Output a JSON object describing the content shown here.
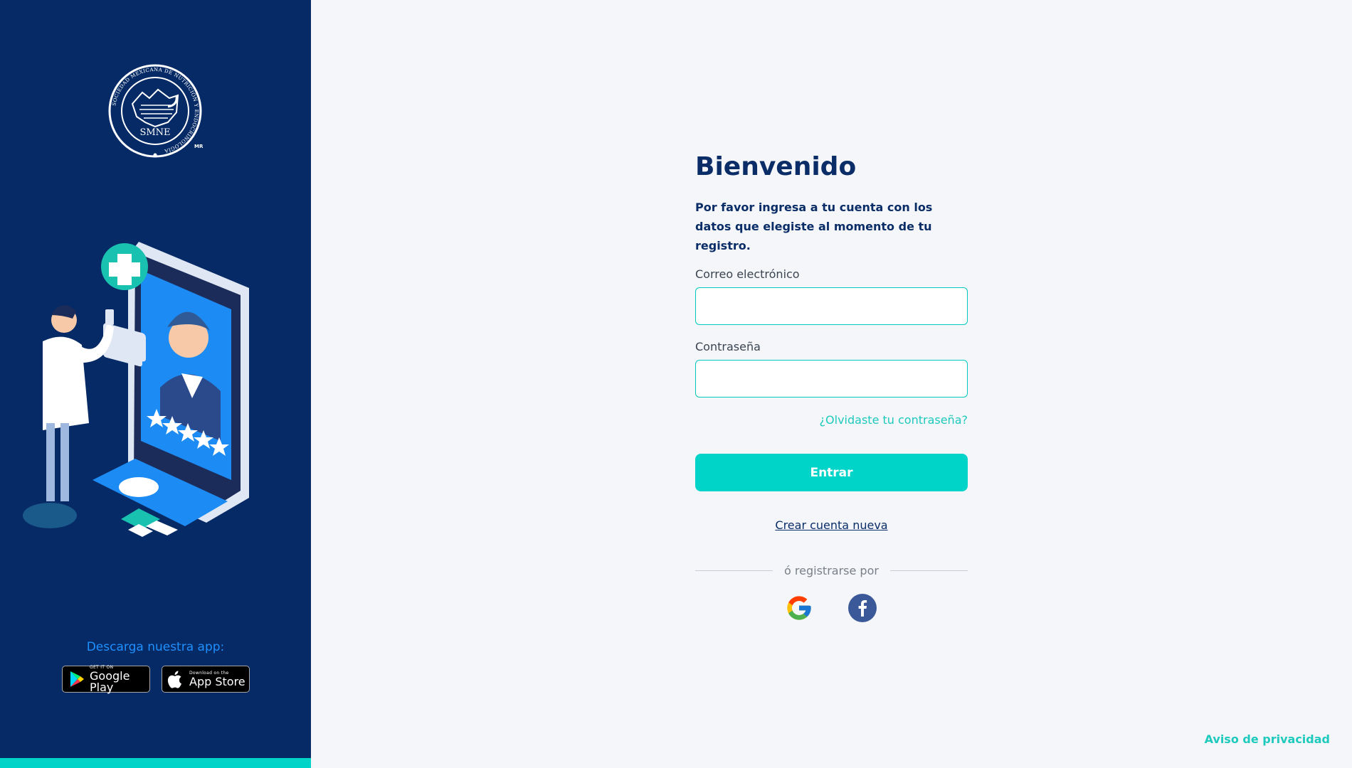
{
  "colors": {
    "sidebar_bg": "#062a65",
    "accent": "#00d4c8",
    "title": "#0a2d68",
    "link": "#1ec9bd",
    "download_label": "#1e90ff"
  },
  "sidebar": {
    "logo_text": "SMNE",
    "logo_ring_text": "SOCIEDAD MEXICANA DE NUTRICIÓN Y ENDOCRINOLOGÍA",
    "logo_mark": "MR",
    "download_label": "Descarga nuestra app:",
    "google_play": {
      "small": "GET IT ON",
      "big": "Google Play"
    },
    "app_store": {
      "small": "Download on the",
      "big": "App Store"
    }
  },
  "form": {
    "title": "Bienvenido",
    "subtitle": "Por favor ingresa a tu cuenta con los datos que elegiste al momento de tu registro.",
    "email_label": "Correo electrónico",
    "email_value": "",
    "password_label": "Contraseña",
    "password_value": "",
    "forgot_link": "¿Olvidaste tu contraseña?",
    "submit_label": "Entrar",
    "create_account_link": "Crear cuenta nueva",
    "social_divider": "ó registrarse por",
    "social_icons": [
      "google-icon",
      "facebook-icon"
    ]
  },
  "footer": {
    "privacy_link": "Aviso de privacidad"
  }
}
